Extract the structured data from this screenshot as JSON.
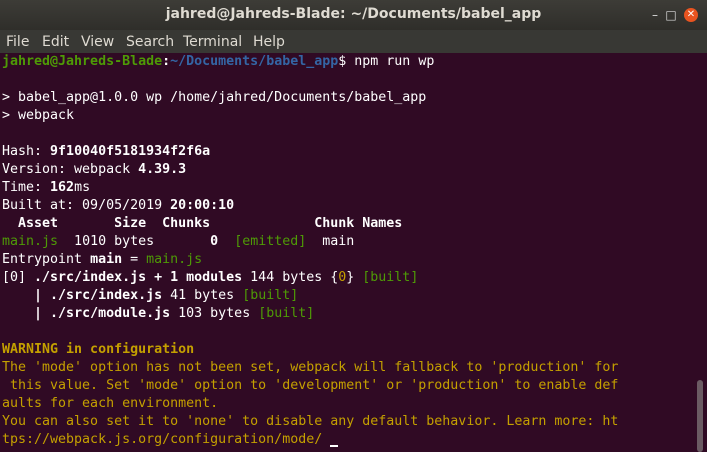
{
  "window": {
    "title": "jahred@Jahreds-Blade: ~/Documents/babel_app"
  },
  "menu": [
    "File",
    "Edit",
    "View",
    "Search",
    "Terminal",
    "Help"
  ],
  "prompt": {
    "user_host": "jahred@Jahreds-Blade",
    "sep": ":",
    "path": "~/Documents/babel_app",
    "symbol": "$",
    "command": " npm run wp"
  },
  "npm": {
    "line1": "> babel_app@1.0.0 wp /home/jahred/Documents/babel_app",
    "line2": "> webpack"
  },
  "stats": {
    "hash_label": "Hash: ",
    "hash": "9f10040f5181934f2f6a",
    "version_label": "Version: webpack ",
    "version": "4.39.3",
    "time_label": "Time: ",
    "time": "162",
    "time_unit": "ms",
    "built_label": "Built at: 09/05/2019 ",
    "built_time": "20:00:10"
  },
  "table": {
    "header": "  Asset       Size  Chunks             Chunk Names",
    "asset": "main.js",
    "size": "  1010 bytes       ",
    "chunk": "0",
    "gap": "  ",
    "emitted": "[emitted]",
    "names": "  main"
  },
  "entry": {
    "label": "Entrypoint ",
    "name": "main",
    "eq": " = ",
    "file": "main.js"
  },
  "modules": {
    "m0_id": "[0] ",
    "m0_path": "./src/index.js + 1 modules",
    "m0_size": " 144 bytes {",
    "m0_chunk": "0",
    "m0_close": "} ",
    "built": "[built]",
    "m1_prefix": "    | ",
    "m1_path": "./src/index.js",
    "m1_size": " 41 bytes ",
    "m2_prefix": "    | ",
    "m2_path": "./src/module.js",
    "m2_size": " 103 bytes "
  },
  "warning": {
    "heading": "WARNING in configuration",
    "l1": "The 'mode' option has not been set, webpack will fallback to 'production' for",
    "l2": " this value. Set 'mode' option to 'development' or 'production' to enable def",
    "l3": "aults for each environment.",
    "l4": "You can also set it to 'none' to disable any default behavior. Learn more: ht",
    "l5": "tps://webpack.js.org/configuration/mode/"
  },
  "colors": {
    "background": "#300a24",
    "green": "#4e9a06",
    "blue": "#3465a4",
    "yellow": "#c4a000",
    "light_green": "#8ae234",
    "close_button": "#e95420"
  }
}
